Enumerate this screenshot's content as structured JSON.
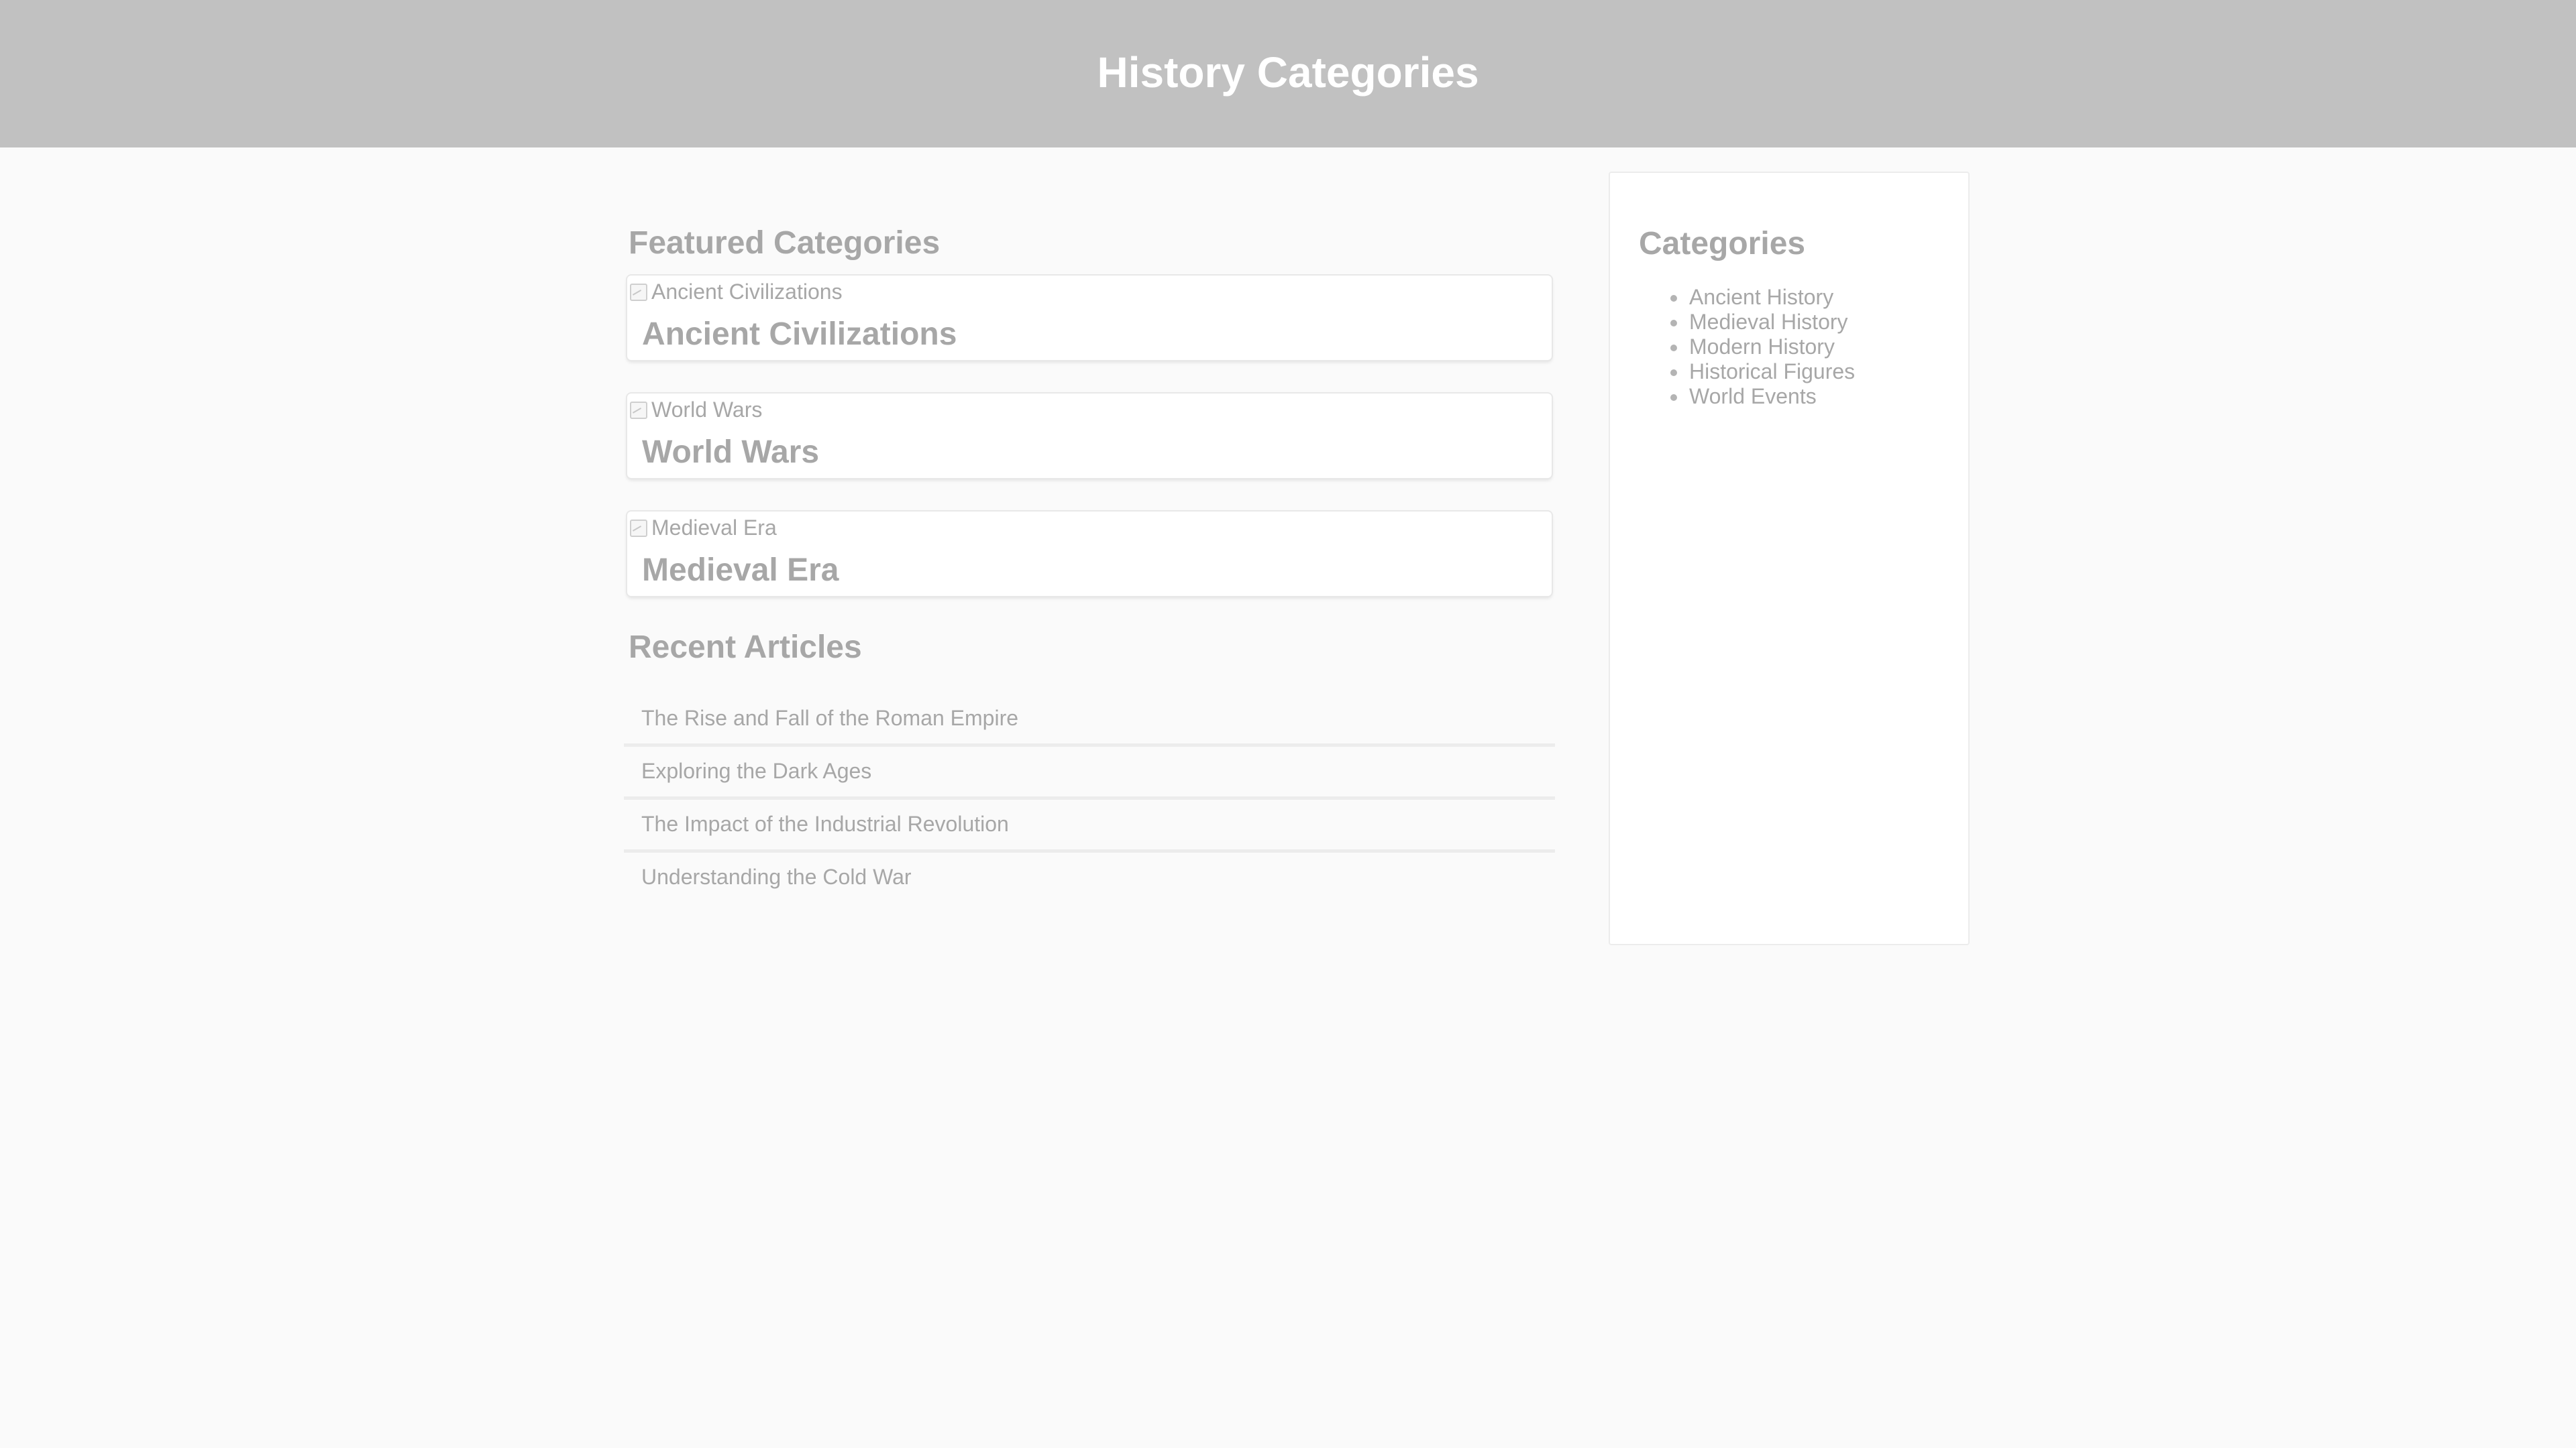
{
  "header": {
    "title": "History Categories"
  },
  "featured": {
    "heading": "Featured Categories",
    "cards": [
      {
        "image_alt": "Ancient Civilizations",
        "title": "Ancient Civilizations"
      },
      {
        "image_alt": "World Wars",
        "title": "World Wars"
      },
      {
        "image_alt": "Medieval Era",
        "title": "Medieval Era"
      }
    ]
  },
  "recent": {
    "heading": "Recent Articles",
    "articles": [
      {
        "title": "The Rise and Fall of the Roman Empire"
      },
      {
        "title": "Exploring the Dark Ages"
      },
      {
        "title": "The Impact of the Industrial Revolution"
      },
      {
        "title": "Understanding the Cold War"
      }
    ]
  },
  "sidebar": {
    "heading": "Categories",
    "items": [
      {
        "label": "Ancient History"
      },
      {
        "label": "Medieval History"
      },
      {
        "label": "Modern History"
      },
      {
        "label": "Historical Figures"
      },
      {
        "label": "World Events"
      }
    ]
  },
  "colors": {
    "header_bg": "#c1c1c1",
    "page_bg": "#fafafa",
    "text_muted": "#a7a7a7",
    "title_text": "#ffffff"
  }
}
